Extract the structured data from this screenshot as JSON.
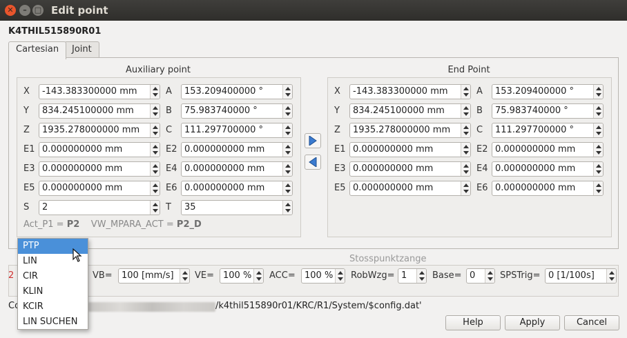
{
  "window": {
    "title": "Edit point"
  },
  "point_name": "K4THIL515890R01",
  "tabs": [
    {
      "label": "Cartesian",
      "active": true
    },
    {
      "label": "Joint",
      "active": false
    }
  ],
  "aux": {
    "title": "Auxiliary point",
    "rows": [
      {
        "l1": "X",
        "v1": "-143.383300000 mm",
        "l2": "A",
        "v2": "153.209400000 °"
      },
      {
        "l1": "Y",
        "v1": "834.245100000 mm",
        "l2": "B",
        "v2": "75.983740000 °"
      },
      {
        "l1": "Z",
        "v1": "1935.278000000 mm",
        "l2": "C",
        "v2": "111.297700000 °"
      },
      {
        "l1": "E1",
        "v1": "0.000000000 mm",
        "l2": "E2",
        "v2": "0.000000000 mm"
      },
      {
        "l1": "E3",
        "v1": "0.000000000 mm",
        "l2": "E4",
        "v2": "0.000000000 mm"
      },
      {
        "l1": "E5",
        "v1": "0.000000000 mm",
        "l2": "E6",
        "v2": "0.000000000 mm"
      },
      {
        "l1": "S",
        "v1": "2",
        "l2": "T",
        "v2": "35"
      }
    ],
    "act_p1_label": "Act_P1 =",
    "act_p1_value": "P2",
    "vw_label": "VW_MPARA_ACT =",
    "vw_value": "P2_D"
  },
  "end": {
    "title": "End Point",
    "rows": [
      {
        "l1": "X",
        "v1": "-143.383300000 mm",
        "l2": "A",
        "v2": "153.209400000 °"
      },
      {
        "l1": "Y",
        "v1": "834.245100000 mm",
        "l2": "B",
        "v2": "75.983740000 °"
      },
      {
        "l1": "Z",
        "v1": "1935.278000000 mm",
        "l2": "C",
        "v2": "111.297700000 °"
      },
      {
        "l1": "E1",
        "v1": "0.000000000 mm",
        "l2": "E2",
        "v2": "0.000000000 mm"
      },
      {
        "l1": "E3",
        "v1": "0.000000000 mm",
        "l2": "E4",
        "v2": "0.000000000 mm"
      },
      {
        "l1": "E5",
        "v1": "0.000000000 mm",
        "l2": "E6",
        "v2": "0.000000000 mm"
      }
    ]
  },
  "motion": {
    "title": "Stosspunktzange",
    "row_prefix": "2",
    "vb_label": "VB=",
    "vb_value": "100 [mm/s]",
    "ve_label": "VE=",
    "ve_value": "100 %",
    "acc_label": "ACC=",
    "acc_value": "100 %",
    "robwzg_label": "RobWzg=",
    "robwzg_value": "1",
    "base_label": "Base=",
    "base_value": "0",
    "spstrig_label": "SPSTrig=",
    "spstrig_value": "0 [1/100s]"
  },
  "motion_type_dropdown": {
    "selected": "PTP",
    "options": [
      "PTP",
      "LIN",
      "CIR",
      "KLIN",
      "KCIR",
      "LIN SUCHEN"
    ]
  },
  "config": {
    "prefix": "Co",
    "path_suffix": "/k4thil515890r01/KRC/R1/System/$config.dat'"
  },
  "buttons": {
    "help": "Help",
    "apply": "Apply",
    "cancel": "Cancel"
  },
  "colors": {
    "accent": "#4a90d9",
    "titlebar": "#3a3935",
    "close": "#e9552c",
    "row_prefix": "#d03030"
  }
}
